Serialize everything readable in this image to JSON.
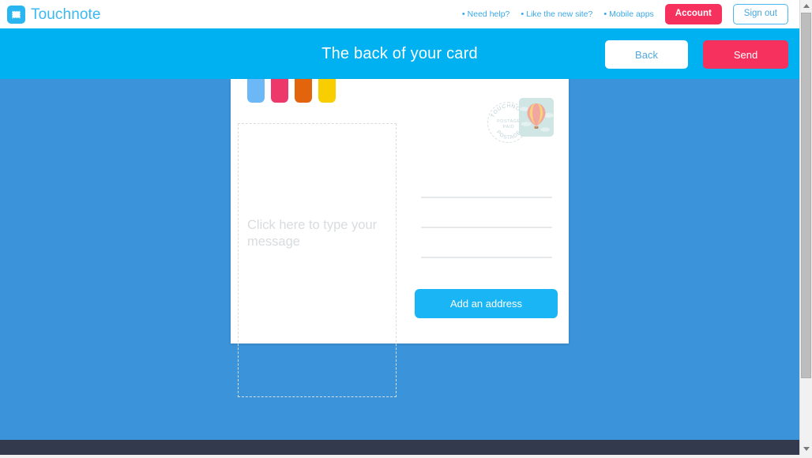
{
  "brand": {
    "name": "Touchnote",
    "logo_icon": "stamp-icon",
    "logo_color": "#29b6f0"
  },
  "topnav": {
    "links": [
      {
        "bullet": "•",
        "label": "Need help?"
      },
      {
        "bullet": "•",
        "label": "Like the new site?"
      },
      {
        "bullet": "•",
        "label": "Mobile apps"
      }
    ],
    "account_label": "Account",
    "signout_label": "Sign out",
    "account_color": "#f6315e",
    "link_color": "#3ba9e8"
  },
  "actionbar": {
    "title": "The back of your card",
    "back_label": "Back",
    "send_label": "Send",
    "bg_color": "#00b1f2",
    "send_color": "#f6315e"
  },
  "card": {
    "swatches": [
      {
        "name": "blue",
        "color": "#6cb8f6"
      },
      {
        "name": "pink",
        "color": "#ec386b"
      },
      {
        "name": "orange",
        "color": "#e2650d"
      },
      {
        "name": "yellow",
        "color": "#f8ce00"
      }
    ],
    "message": {
      "placeholder": "Click here to type your message",
      "value": "",
      "placeholder_color": "#d8dcdf"
    },
    "stamp": {
      "postmark_lines": [
        "TOUCHNOTE",
        "POSTAGE",
        "PAID",
        "POSTAGE"
      ],
      "artwork_icon": "hot-air-balloon-icon",
      "artwork_bg": "#cfe6e4"
    },
    "address": {
      "lines": [
        "",
        "",
        ""
      ],
      "add_button_label": "Add an address",
      "add_button_color": "#19b5f5"
    }
  },
  "page": {
    "background_color": "#3b93d9",
    "footer_color": "#343a4d"
  },
  "scrollbar": {
    "up_icon": "arrow-up-icon",
    "down_icon": "arrow-down-icon"
  }
}
